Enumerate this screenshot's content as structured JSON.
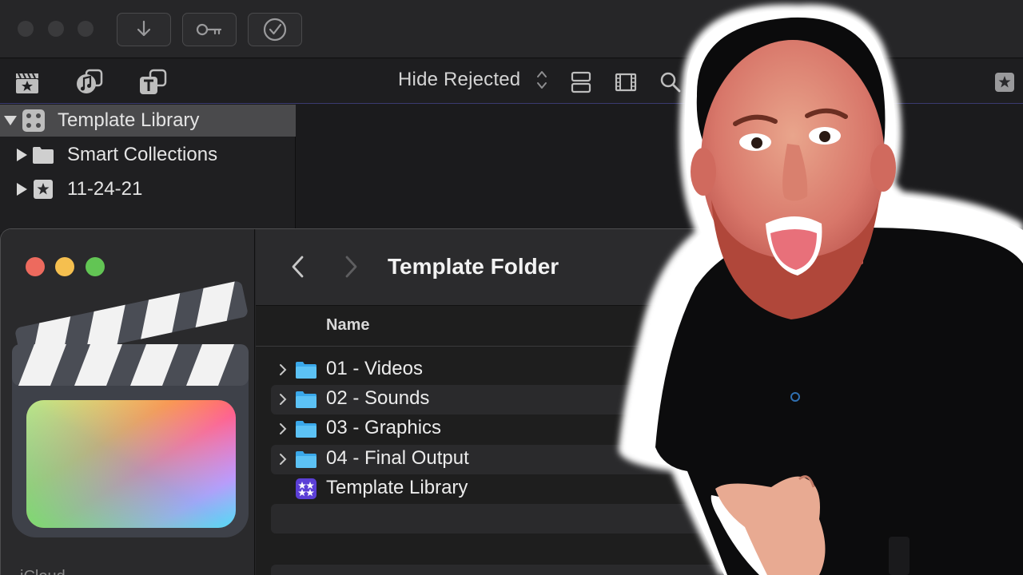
{
  "toolbar": {
    "download_icon": "download-arrow-icon",
    "key_icon": "key-icon",
    "check_icon": "checkmark-circle-icon",
    "filter_label": "Hide Rejected"
  },
  "library": {
    "items": [
      {
        "label": "Template Library",
        "icon": "library-grid-icon",
        "expanded": true,
        "selected": true
      },
      {
        "label": "Smart Collections",
        "icon": "folder-icon",
        "expanded": false
      },
      {
        "label": "11-24-21",
        "icon": "star-event-icon",
        "expanded": false
      }
    ]
  },
  "finder": {
    "title": "Template Folder",
    "column_name": "Name",
    "sidebar_bottom_label": "iCloud",
    "rows": [
      {
        "label": "01 - Videos",
        "type": "folder"
      },
      {
        "label": "02 - Sounds",
        "type": "folder"
      },
      {
        "label": "03 - Graphics",
        "type": "folder"
      },
      {
        "label": "04 - Final Output",
        "type": "folder"
      },
      {
        "label": "Template Library",
        "type": "fcp-library"
      }
    ]
  },
  "colors": {
    "accent_blue": "#2f9ce8",
    "traffic_red": "#ed6a5e",
    "traffic_yellow": "#f5bf4f",
    "traffic_green": "#62c554",
    "library_purple": "#5b3fd6"
  }
}
